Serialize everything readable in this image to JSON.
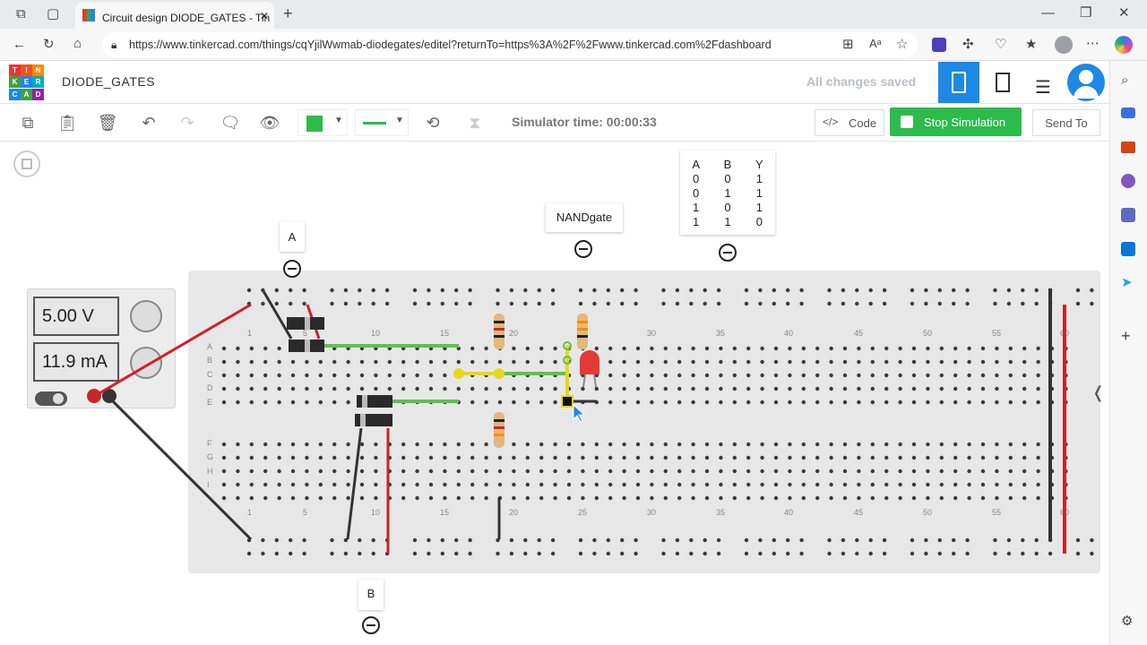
{
  "browser": {
    "tab_title": "Circuit design DIODE_GATES - Tin",
    "url": "https://www.tinkercad.com/things/cqYjilWwmab-diodegates/editel?returnTo=https%3A%2F%2Fwww.tinkercad.com%2Fdashboard"
  },
  "header": {
    "logo_letters": [
      "T",
      "I",
      "N",
      "K",
      "E",
      "R",
      "C",
      "A",
      "D"
    ],
    "title": "DIODE_GATES",
    "saved_status": "All changes saved"
  },
  "toolbar": {
    "sim_time": "Simulator time: 00:00:33",
    "code_label": "Code",
    "stop_label": "Stop Simulation",
    "send_label": "Send To",
    "color_value": "#2dbb4c"
  },
  "canvas": {
    "note_a": "A",
    "note_b": "B",
    "note_gate": "NANDgate",
    "truth_table": {
      "headers": [
        "A",
        "B",
        "Y"
      ],
      "rows": [
        [
          "0",
          "0",
          "1"
        ],
        [
          "0",
          "1",
          "1"
        ],
        [
          "1",
          "0",
          "1"
        ],
        [
          "1",
          "1",
          "0"
        ]
      ]
    },
    "supply": {
      "voltage": "5.00 V",
      "current": "11.9 mA"
    },
    "column_numbers": [
      "1",
      "5",
      "10",
      "15",
      "20",
      "25",
      "30",
      "35",
      "40",
      "45",
      "50",
      "55",
      "60"
    ],
    "row_letters_top": [
      "A",
      "B",
      "C",
      "D",
      "E"
    ],
    "row_letters_bottom": [
      "F",
      "G",
      "H",
      "I"
    ]
  },
  "colors": {
    "accent": "#2dbb4c",
    "wire_red": "#d0202a",
    "wire_green": "#5ec24c",
    "tinker_blue": "#1e88e5"
  }
}
